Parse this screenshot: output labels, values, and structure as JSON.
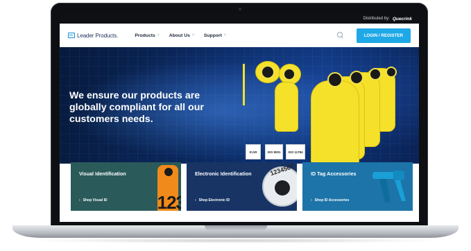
{
  "topbar": {
    "distributed_label": "Distributed by:",
    "distributor": "Quecrink"
  },
  "nav": {
    "brand": "Leader Products.",
    "items": [
      {
        "label": "Products",
        "chevron": "˅"
      },
      {
        "label": "About Us",
        "chevron": "˅"
      },
      {
        "label": "Support",
        "chevron": "˅"
      }
    ],
    "search_icon": "search-icon",
    "login_label": "LOGIN / REGISTER"
  },
  "hero": {
    "headline": "We ensure our products are globally compliant for all our customers needs.",
    "certs": [
      "ICAR",
      "ISO 9001",
      "ISO 11784"
    ]
  },
  "cards": [
    {
      "title": "Visual Identification",
      "link": "Shop Visual ID",
      "image_text": "123"
    },
    {
      "title": "Electronic Identification",
      "link": "Shop Electronic ID",
      "image_text": "1234567"
    },
    {
      "title": "ID Tag Accessories",
      "link": "Shop ID Accessories"
    }
  ],
  "colors": {
    "accent": "#1fa8e6",
    "tag_yellow": "#f5e12a",
    "card_visual": "#2b5a5a",
    "card_electronic": "#173465",
    "card_accessories": "#1c74a8"
  }
}
